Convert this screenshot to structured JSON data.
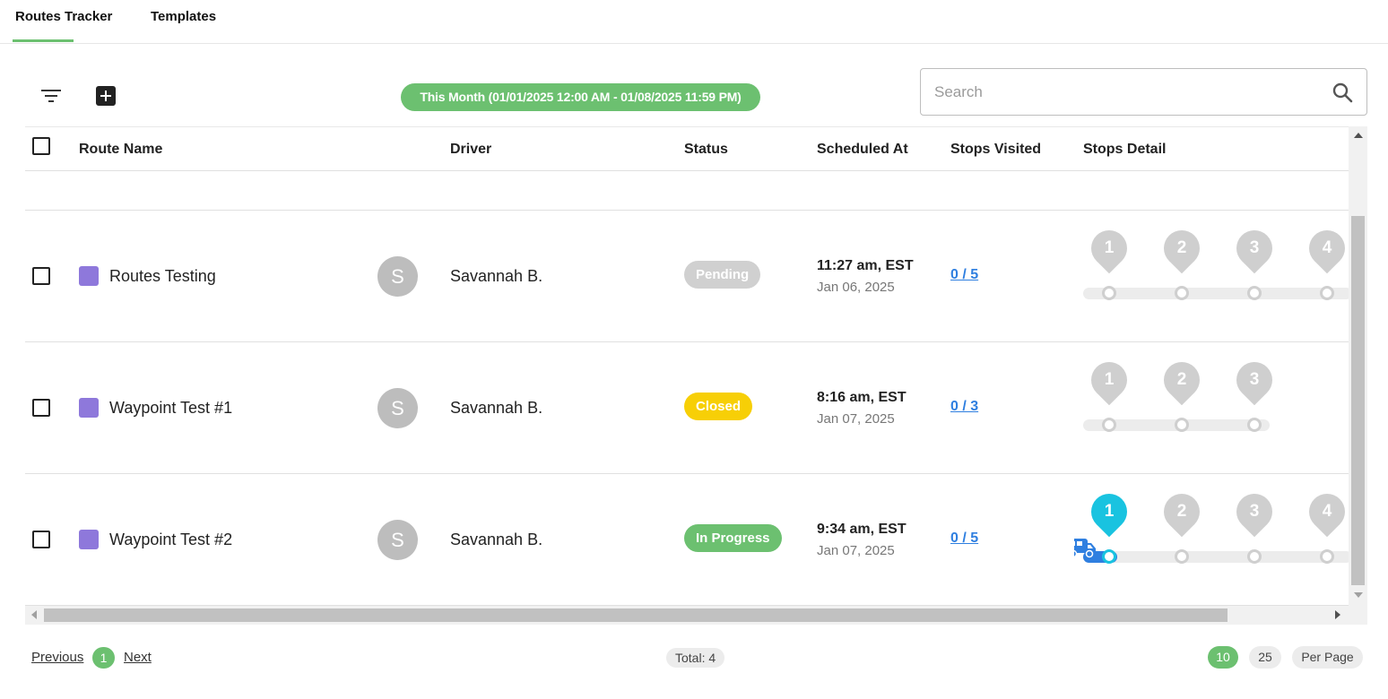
{
  "tabs": [
    {
      "label": "Routes Tracker",
      "active": true
    },
    {
      "label": "Templates",
      "active": false
    }
  ],
  "toolbar": {
    "filter_icon": "filter-icon",
    "add_icon": "add-icon",
    "date_range": "This Month (01/01/2025 12:00 AM - 01/08/2025 11:59 PM)",
    "accent_color": "#6cc070"
  },
  "search": {
    "placeholder": "Search",
    "value": ""
  },
  "table": {
    "headers": [
      "Route Name",
      "Driver",
      "Status",
      "Scheduled At",
      "Stops Visited",
      "Stops Detail"
    ],
    "rows": [
      {
        "route_name": "Routes Testing",
        "route_color": "#8e78db",
        "avatar": "S",
        "driver": "Savannah B.",
        "status": "Pending",
        "status_color": "#d0d0d0",
        "time": "11:27 am, EST",
        "date": "Jan 06, 2025",
        "stops_visited": "0 / 5",
        "stops": [
          "1",
          "2",
          "3",
          "4"
        ],
        "active_stop": null
      },
      {
        "route_name": "Waypoint Test #1",
        "route_color": "#8e78db",
        "avatar": "S",
        "driver": "Savannah B.",
        "status": "Closed",
        "status_color": "#f7cf06",
        "time": "8:16 am, EST",
        "date": "Jan 07, 2025",
        "stops_visited": "0 / 3",
        "stops": [
          "1",
          "2",
          "3"
        ],
        "active_stop": null
      },
      {
        "route_name": "Waypoint Test #2",
        "route_color": "#8e78db",
        "avatar": "S",
        "driver": "Savannah B.",
        "status": "In Progress",
        "status_color": "#6cc070",
        "time": "9:34 am, EST",
        "date": "Jan 07, 2025",
        "stops_visited": "0 / 5",
        "stops": [
          "1",
          "2",
          "3",
          "4"
        ],
        "active_stop": 0
      }
    ]
  },
  "footer": {
    "previous": "Previous",
    "page": "1",
    "next": "Next",
    "total": "Total: 4",
    "per_page_options": [
      "10",
      "25"
    ],
    "per_page_label": "Per Page"
  }
}
